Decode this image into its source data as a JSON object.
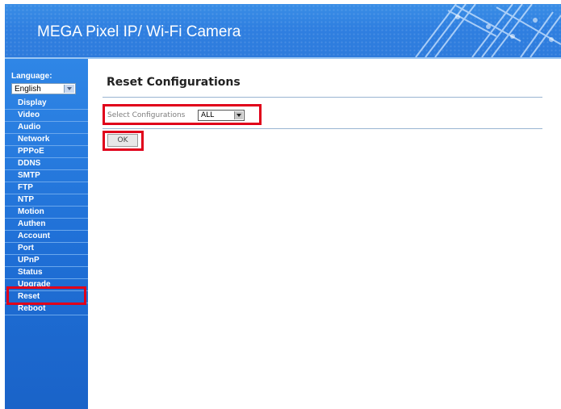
{
  "header": {
    "title": "MEGA Pixel IP/ Wi-Fi Camera"
  },
  "sidebar": {
    "language_label": "Language:",
    "language_value": "English",
    "items": [
      {
        "label": "Display"
      },
      {
        "label": "Video"
      },
      {
        "label": "Audio"
      },
      {
        "label": "Network"
      },
      {
        "label": "PPPoE"
      },
      {
        "label": "DDNS"
      },
      {
        "label": "SMTP"
      },
      {
        "label": "FTP"
      },
      {
        "label": "NTP"
      },
      {
        "label": "Motion"
      },
      {
        "label": "Authen"
      },
      {
        "label": "Account"
      },
      {
        "label": "Port"
      },
      {
        "label": "UPnP"
      },
      {
        "label": "Status"
      },
      {
        "label": "Upgrade"
      },
      {
        "label": "Reset"
      },
      {
        "label": "Reboot"
      }
    ]
  },
  "main": {
    "title": "Reset Configurations",
    "select_label": "Select Configurations",
    "select_value": "ALL",
    "ok_label": "OK"
  },
  "colors": {
    "header_blue": "#2f7fe0",
    "sidebar_blue": "#1f6fd6",
    "highlight_red": "#e0001a"
  }
}
